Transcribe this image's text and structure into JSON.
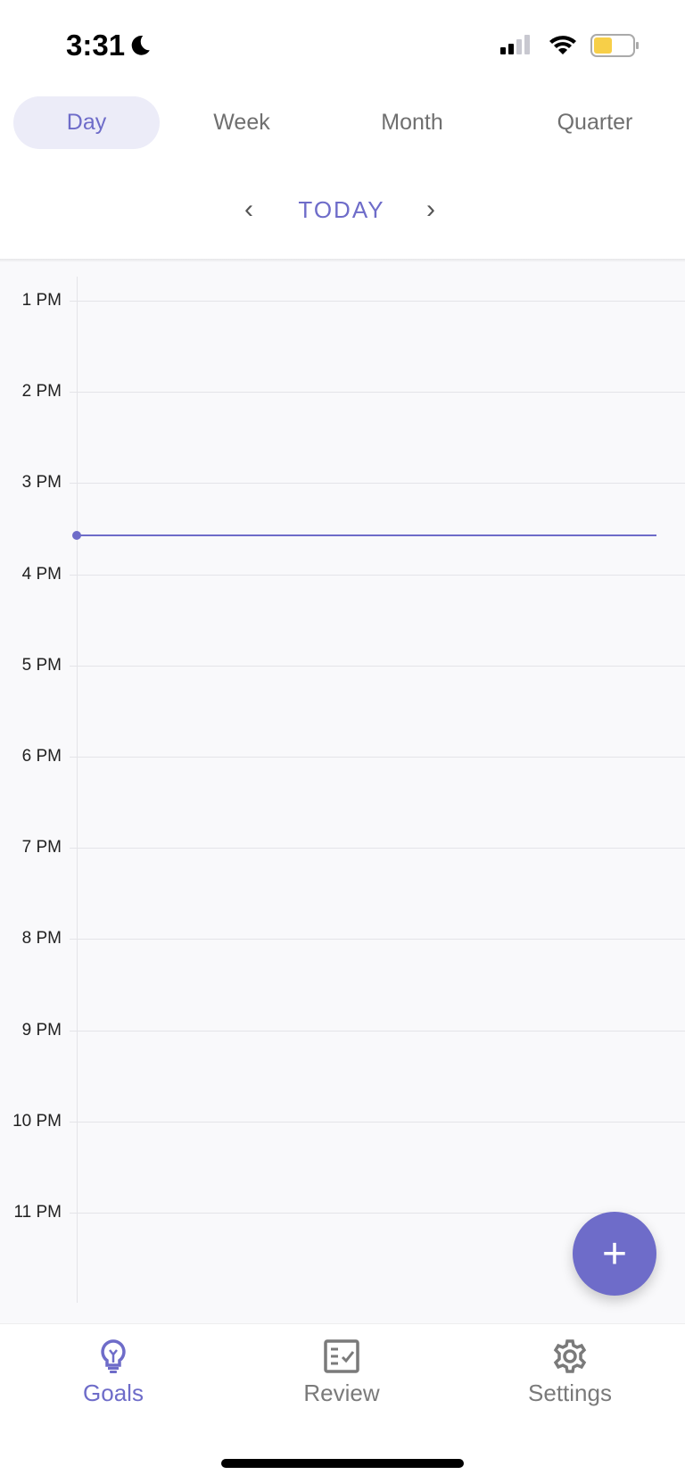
{
  "status_bar": {
    "time": "3:31",
    "focus_icon": "moon-icon",
    "battery_color": "#f7cf48"
  },
  "tabs": [
    {
      "label": "Day",
      "active": true
    },
    {
      "label": "Week"
    },
    {
      "label": "Month"
    },
    {
      "label": "Quarter"
    }
  ],
  "date_nav": {
    "label": "TODAY"
  },
  "calendar": {
    "hours": [
      "1 PM",
      "2 PM",
      "3 PM",
      "4 PM",
      "5 PM",
      "6 PM",
      "7 PM",
      "8 PM",
      "9 PM",
      "10 PM",
      "11 PM"
    ],
    "current_time": "3:31"
  },
  "fab": {
    "label": "+"
  },
  "bottom_tabs": [
    {
      "label": "Goals",
      "icon": "lightbulb-icon",
      "active": true
    },
    {
      "label": "Review",
      "icon": "checklist-icon"
    },
    {
      "label": "Settings",
      "icon": "gear-icon"
    }
  ],
  "colors": {
    "accent": "#6e6cc9",
    "accent_bg": "#ececf8"
  }
}
